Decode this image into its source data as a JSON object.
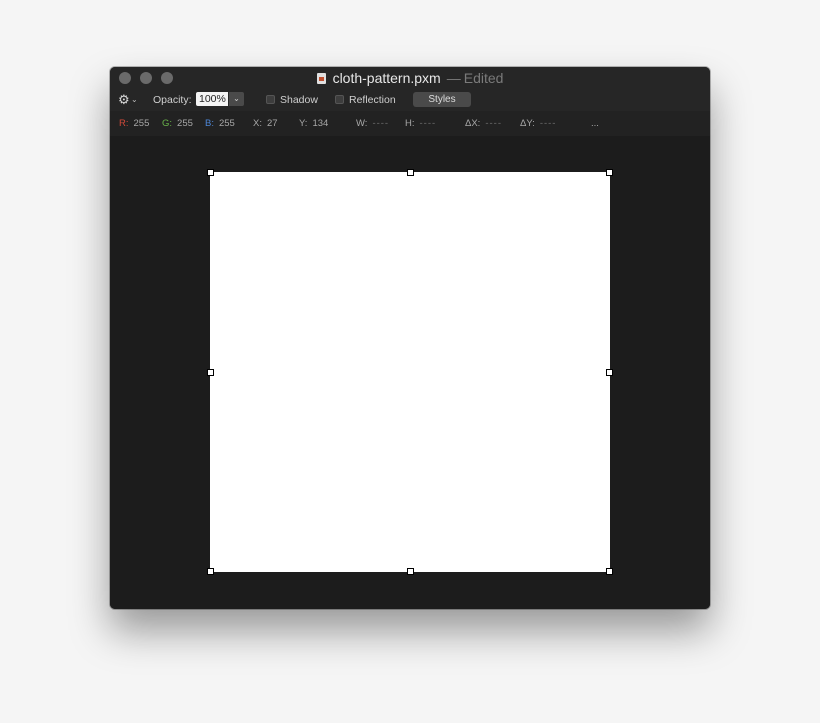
{
  "window": {
    "filename": "cloth-pattern.pxm",
    "separator": "—",
    "status": "Edited"
  },
  "toolbar": {
    "opacity_label": "Opacity:",
    "opacity_value": "100%",
    "shadow_label": "Shadow",
    "shadow_checked": false,
    "reflection_label": "Reflection",
    "reflection_checked": false,
    "styles_label": "Styles"
  },
  "info": {
    "r_label": "R:",
    "r_value": "255",
    "g_label": "G:",
    "g_value": "255",
    "b_label": "B:",
    "b_value": "255",
    "x_label": "X:",
    "x_value": "27",
    "y_label": "Y:",
    "y_value": "134",
    "w_label": "W:",
    "w_value": "----",
    "h_label": "H:",
    "h_value": "----",
    "dx_label": "ΔX:",
    "dx_value": "----",
    "dy_label": "ΔY:",
    "dy_value": "----",
    "more": "..."
  },
  "colors": {
    "window_bg": "#1c1c1c",
    "canvas": "#ffffff",
    "red_channel": "#d24a3a",
    "green_channel": "#69b34a",
    "blue_channel": "#4d86d6"
  },
  "icons": {
    "gear": "gear-icon",
    "document": "document-icon",
    "chevron": "chevron-down-icon"
  }
}
